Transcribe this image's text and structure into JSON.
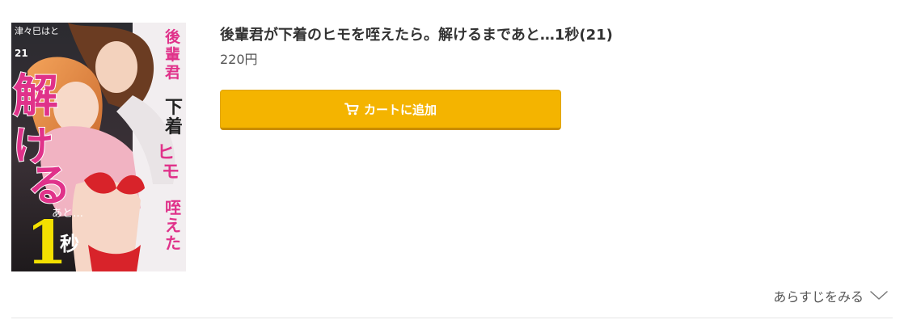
{
  "product": {
    "cover_alt": "後輩君が下着のヒモを咥えたら。解けるまであと…1秒(21)",
    "cover_text": {
      "author": "津々巳はと",
      "volume": "21",
      "vertical_title": "後輩君が下着のヒモを咥えたら。",
      "big_title": "解けるまで",
      "countdown": "あと…",
      "seconds_number": "1",
      "seconds_unit": "秒"
    },
    "title": "後輩君が下着のヒモを咥えたら。解けるまであと…1秒(21)",
    "price": "220円"
  },
  "actions": {
    "cart_label": "カートに追加",
    "cart_icon": "cart-icon"
  },
  "synopsis": {
    "toggle_label": "あらすじをみる",
    "toggle_icon": "chevron-down-icon"
  },
  "colors": {
    "cart_button": "#f4b400",
    "cover_pink": "#e0328a",
    "cover_red": "#d8232a"
  }
}
